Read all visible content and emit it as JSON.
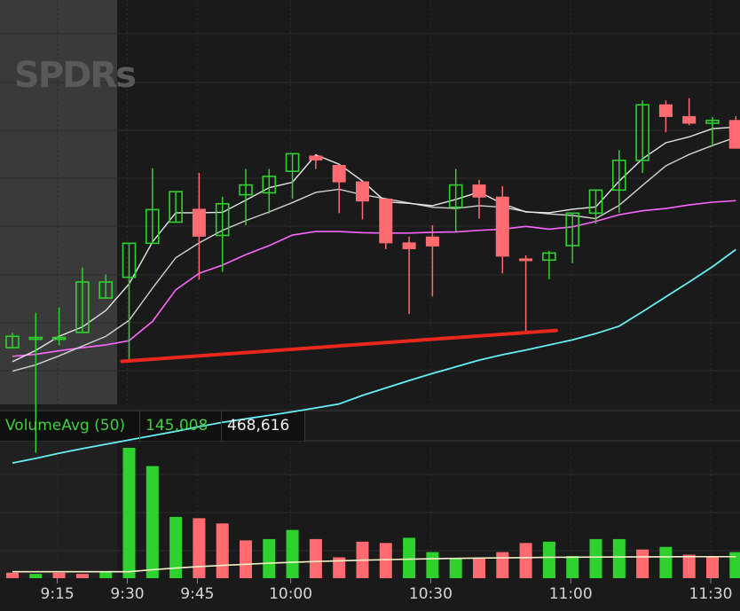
{
  "watermark": "SPDRs",
  "volume_panel": {
    "indicator_label": "VolumeAvg (50)",
    "avg_value": "145,008",
    "current_value": "468,616"
  },
  "colors": {
    "background": "#1a1a1a",
    "premarket_shade": "#3a3a3a",
    "up_candle": "#2fd12f",
    "down_candle": "#ff6b70",
    "ma_fast": "#e8e8e8",
    "ma_slow": "#d2d2d2",
    "ma_magenta": "#ff66ff",
    "ma_cyan": "#66f0f5",
    "trendline": "#e8281d",
    "volume_avg_line": "#f4f0c8"
  },
  "chart_data": {
    "type": "candlestick",
    "time_axis": {
      "tick_labels": [
        "9:15",
        "9:30",
        "9:45",
        "10:00",
        "10:30",
        "11:00",
        "11:30"
      ],
      "bars_per_tick_index": [
        2,
        5,
        8,
        12,
        18,
        24,
        30
      ]
    },
    "price_ylim": [
      0,
      100
    ],
    "volume_ylim": [
      0,
      100
    ],
    "candles": [
      {
        "o": 14.5,
        "h": 18.3,
        "l": 15.1,
        "c": 17.4
      },
      {
        "o": 17.1,
        "h": 23.4,
        "l": -12.4,
        "c": 17.1
      },
      {
        "o": 17.1,
        "h": 24.8,
        "l": 15.1,
        "c": 17.1
      },
      {
        "o": 18.4,
        "h": 35.0,
        "l": 18.4,
        "c": 31.3
      },
      {
        "o": 27.2,
        "h": 33.2,
        "l": 27.2,
        "c": 31.3
      },
      {
        "o": 32.5,
        "h": 33.9,
        "l": 11.6,
        "c": 41.2
      },
      {
        "o": 41.2,
        "h": 60.4,
        "l": 41.2,
        "c": 49.8
      },
      {
        "o": 46.6,
        "h": 53.9,
        "l": 46.6,
        "c": 54.4
      },
      {
        "o": 49.9,
        "h": 59.2,
        "l": 31.9,
        "c": 43.0
      },
      {
        "o": 43.2,
        "h": 53.1,
        "l": 33.9,
        "c": 51.3
      },
      {
        "o": 53.6,
        "h": 60.2,
        "l": 45.8,
        "c": 56.1
      },
      {
        "o": 54.1,
        "h": 60.2,
        "l": 48.8,
        "c": 58.3
      },
      {
        "o": 59.6,
        "h": 60.5,
        "l": 52.6,
        "c": 64.1
      },
      {
        "o": 63.5,
        "h": 63.5,
        "l": 60.2,
        "c": 62.5
      },
      {
        "o": 61.1,
        "h": 61.1,
        "l": 48.9,
        "c": 56.9
      },
      {
        "o": 56.9,
        "h": 56.6,
        "l": 47.3,
        "c": 52.0
      },
      {
        "o": 52.5,
        "h": 52.0,
        "l": 39.7,
        "c": 41.3
      },
      {
        "o": 41.3,
        "h": 42.9,
        "l": 23.1,
        "c": 39.8
      },
      {
        "o": 42.8,
        "h": 45.8,
        "l": 27.6,
        "c": 40.5
      },
      {
        "o": 50.4,
        "h": 60.2,
        "l": 44.2,
        "c": 56.1
      },
      {
        "o": 56.1,
        "h": 57.4,
        "l": 47.5,
        "c": 53.0
      },
      {
        "o": 53.0,
        "h": 55.8,
        "l": 33.5,
        "c": 37.9
      },
      {
        "o": 37.2,
        "h": 38.1,
        "l": 18.2,
        "c": 36.9
      },
      {
        "o": 36.9,
        "h": 39.3,
        "l": 32.0,
        "c": 38.7
      },
      {
        "o": 40.6,
        "h": 46.1,
        "l": 36.1,
        "c": 48.9
      },
      {
        "o": 48.9,
        "h": 54.9,
        "l": 46.2,
        "c": 54.8
      },
      {
        "o": 54.8,
        "h": 65.0,
        "l": 49.0,
        "c": 62.4
      },
      {
        "o": 62.4,
        "h": 77.7,
        "l": 59.2,
        "c": 76.6
      },
      {
        "o": 76.6,
        "h": 77.7,
        "l": 69.6,
        "c": 73.6
      },
      {
        "o": 73.6,
        "h": 78.3,
        "l": 71.4,
        "c": 71.9
      },
      {
        "o": 71.9,
        "h": 73.5,
        "l": 65.9,
        "c": 72.6
      },
      {
        "o": 72.6,
        "h": 73.7,
        "l": 65.5,
        "c": 65.5
      }
    ],
    "ma_fast_values": [
      10.9,
      13.8,
      17.4,
      19.8,
      24.0,
      30.8,
      41.5,
      49.0,
      49.0,
      49.1,
      52.2,
      55.4,
      56.8,
      63.8,
      61.4,
      57.1,
      51.8,
      51.4,
      50.8,
      52.4,
      54.3,
      51.3,
      49.2,
      49.0,
      49.9,
      50.5,
      57.1,
      62.8,
      66.9,
      68.4,
      70.5,
      70.9
    ],
    "ma_slow_values": [
      8.5,
      10.1,
      12.4,
      14.9,
      17.4,
      21.5,
      29.7,
      37.5,
      41.3,
      44.5,
      47.0,
      49.2,
      51.6,
      54.2,
      55.0,
      53.6,
      52.6,
      51.5,
      50.4,
      50.1,
      50.8,
      50.4,
      49.3,
      48.7,
      48.3,
      47.5,
      50.9,
      56.0,
      61.0,
      63.9,
      66.2,
      68.3
    ],
    "ma_magenta_values": [
      12.3,
      12.8,
      13.7,
      14.5,
      15.2,
      16.3,
      21.2,
      29.3,
      33.5,
      35.6,
      38.3,
      40.6,
      43.3,
      44.2,
      44.2,
      43.9,
      43.8,
      43.8,
      44.0,
      44.1,
      44.5,
      44.8,
      45.5,
      44.8,
      45.4,
      46.8,
      48.5,
      49.5,
      50.1,
      51.0,
      51.7,
      52.1
    ],
    "ma_cyan_values": [
      -15.0,
      -13.8,
      -12.5,
      -11.3,
      -10.2,
      -9.1,
      -8.0,
      -6.9,
      -5.7,
      -4.6,
      -3.7,
      -2.8,
      -1.9,
      -0.9,
      0.1,
      2.3,
      4.2,
      6.1,
      7.9,
      9.6,
      11.3,
      12.7,
      13.9,
      15.2,
      16.5,
      18.1,
      20.0,
      23.7,
      27.5,
      31.3,
      35.2,
      39.6
    ],
    "trendline": {
      "from": {
        "bar": 5,
        "y": 11.0
      },
      "to": {
        "bar": 23,
        "y": 18.9
      }
    },
    "volume": [
      {
        "v": 4.2,
        "up": false
      },
      {
        "v": 3.3,
        "up": true
      },
      {
        "v": 4.2,
        "up": false
      },
      {
        "v": 3.3,
        "up": false
      },
      {
        "v": 5.0,
        "up": true
      },
      {
        "v": 100.0,
        "up": true
      },
      {
        "v": 86.0,
        "up": true
      },
      {
        "v": 47.0,
        "up": true
      },
      {
        "v": 46.0,
        "up": false
      },
      {
        "v": 42.0,
        "up": false
      },
      {
        "v": 29.0,
        "up": false
      },
      {
        "v": 30.0,
        "up": true
      },
      {
        "v": 37.0,
        "up": true
      },
      {
        "v": 30.0,
        "up": false
      },
      {
        "v": 16.0,
        "up": false
      },
      {
        "v": 28.0,
        "up": false
      },
      {
        "v": 27.0,
        "up": false
      },
      {
        "v": 31.0,
        "up": true
      },
      {
        "v": 20.0,
        "up": true
      },
      {
        "v": 15.0,
        "up": true
      },
      {
        "v": 15.0,
        "up": false
      },
      {
        "v": 20.0,
        "up": false
      },
      {
        "v": 27.0,
        "up": false
      },
      {
        "v": 28.0,
        "up": true
      },
      {
        "v": 17.0,
        "up": true
      },
      {
        "v": 30.0,
        "up": true
      },
      {
        "v": 30.0,
        "up": true
      },
      {
        "v": 22.0,
        "up": false
      },
      {
        "v": 24.0,
        "up": true
      },
      {
        "v": 18.0,
        "up": false
      },
      {
        "v": 16.0,
        "up": false
      },
      {
        "v": 20.0,
        "up": true
      }
    ],
    "volume_avg_values": [
      5.0,
      5.0,
      5.0,
      5.0,
      5.0,
      5.0,
      6.5,
      7.8,
      8.9,
      9.8,
      10.7,
      11.5,
      12.2,
      12.8,
      13.3,
      13.8,
      14.2,
      14.6,
      14.9,
      15.2,
      15.4,
      15.6,
      15.8,
      16.0,
      16.1,
      16.2,
      16.3,
      16.4,
      16.4,
      16.5,
      16.5,
      16.5
    ]
  }
}
